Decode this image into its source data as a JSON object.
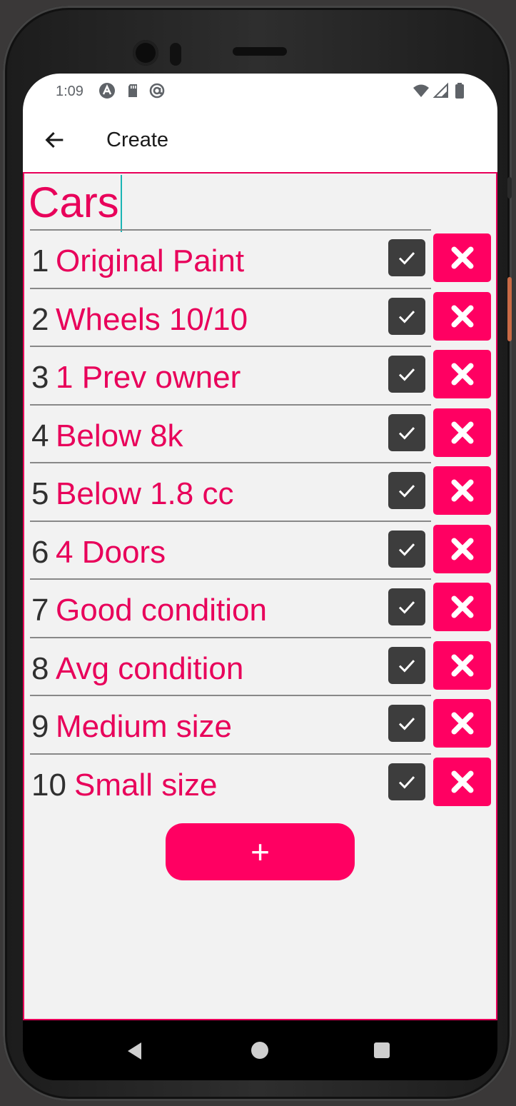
{
  "status_bar": {
    "time": "1:09",
    "left_icons": [
      "a-icon",
      "sd-card-icon",
      "at-icon"
    ],
    "right_icons": [
      "wifi-icon",
      "signal-icon",
      "battery-icon"
    ]
  },
  "app_bar": {
    "title": "Create",
    "back_icon": "arrow-left-icon"
  },
  "list": {
    "title": "Cars",
    "items": [
      {
        "number": "1",
        "label": "Original Paint",
        "checked": true
      },
      {
        "number": "2",
        "label": "Wheels 10/10",
        "checked": true
      },
      {
        "number": "3",
        "label": "1 Prev owner",
        "checked": true
      },
      {
        "number": "4",
        "label": "Below 8k",
        "checked": true
      },
      {
        "number": "5",
        "label": "Below 1.8 cc",
        "checked": true
      },
      {
        "number": "6",
        "label": "4 Doors",
        "checked": true
      },
      {
        "number": "7",
        "label": "Good condition",
        "checked": true
      },
      {
        "number": "8",
        "label": "Avg condition",
        "checked": true
      },
      {
        "number": "9",
        "label": "Medium size",
        "checked": true
      },
      {
        "number": "10",
        "label": "Small size",
        "checked": true
      }
    ],
    "add_label": "+"
  },
  "colors": {
    "accent": "#ff0062",
    "text_accent": "#e8005a",
    "checkbox": "#3d3d3d"
  }
}
